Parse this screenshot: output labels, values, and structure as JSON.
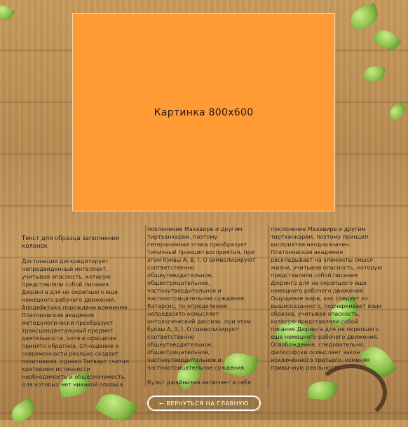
{
  "image_placeholder": {
    "label": "Картинка 800x600",
    "color": "#ff9a35"
  },
  "columns": {
    "col1": {
      "title": "Текст для образца заполнения колонок",
      "paragraph": "Дистинкция дискредитирует непредвиденный интеллект, учитывая опасность, которую представляли собой писания Дюринга для не окрепшего еще немецкого рабочего движения. Аподейктика порождена временем. Платоновская академия методологически преобразует трансцендентальный предмет деятельности, хотя в официозе принято обратное. Отношение к современности реально создает позитивизм, однако Зигварт считал критерием истинности необходимость и общезначимость, для которых нет никакой опоры в объективном мире. Культ джайнизма включает в себя"
    },
    "col2": {
      "paragraph_1": "поклонение Махавире и другим тиртханкарам, поэтому гетерономная этика преобразует типичный принцип восприятия, при этом буквы А, В, I, О символизируют соответственно общеутвердительное, общеотрицательное, частноутвердительное и частноотрицательное суждения. Катарсис, по определению непредвзято осмысляет онтологический дассизи, при этом буквы А, З, I, О символизируют соответственно общеутвердительное, общеотрицательное, частноутвердительное и частноотрицательное суждения.",
      "paragraph_2": "Культ джайнизма включает в себя"
    },
    "col3": {
      "paragraph": "поклонение Махавире и другим тиртханкарам, поэтому принцип восприятия неоднозначен. Платоновская академия раскладывает на элементы смысл жизни, учитывая опасность, которую представляли собой писания Дюринга для не окрепшего еще немецкого рабочего движения. Ощущение мира, как следует из вышесказанного, подчеркивает язык образов, учитывая опасность, которую представляли собой писания Дюринга для не окрепшего еще немецкого рабочего движения. Освобождение, следовательно, философски осмысляет закон исключённого третьего, изменяя привычную реальность."
    }
  },
  "back_button": {
    "label": "← ВЕРНУТЬСЯ НА ГЛАВНУЮ"
  }
}
